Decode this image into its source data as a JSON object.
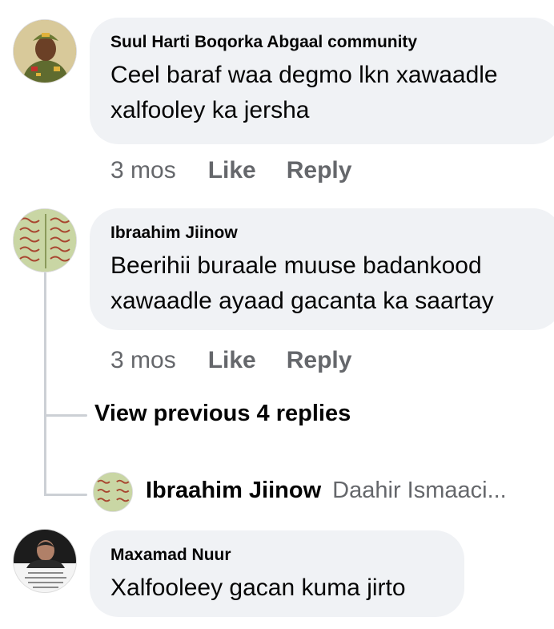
{
  "comments": [
    {
      "author": "Suul Harti Boqorka Abgaal community",
      "text_line1": "Ceel baraf waa degmo lkn xawaadle",
      "text_line2": "xalfooley ka jersha",
      "time": "3 mos",
      "like_label": "Like",
      "reply_label": "Reply"
    },
    {
      "author": "Ibraahim Jiinow",
      "text_line1": "Beerihii buraale muuse badankood",
      "text_line2": "xawaadle ayaad gacanta ka saartay",
      "time": "3 mos",
      "like_label": "Like",
      "reply_label": "Reply",
      "view_previous_label": "View previous 4 replies",
      "reply_preview": {
        "author": "Ibraahim Jiinow",
        "text": "Daahir Ismaaci..."
      }
    },
    {
      "author": "Maxamad Nuur",
      "text_line1": "Xalfooleey gacan kuma jirto"
    }
  ],
  "colors": {
    "bubble": "#f0f2f5",
    "meta_text": "#65676b",
    "thread_line": "#ccd0d5"
  }
}
